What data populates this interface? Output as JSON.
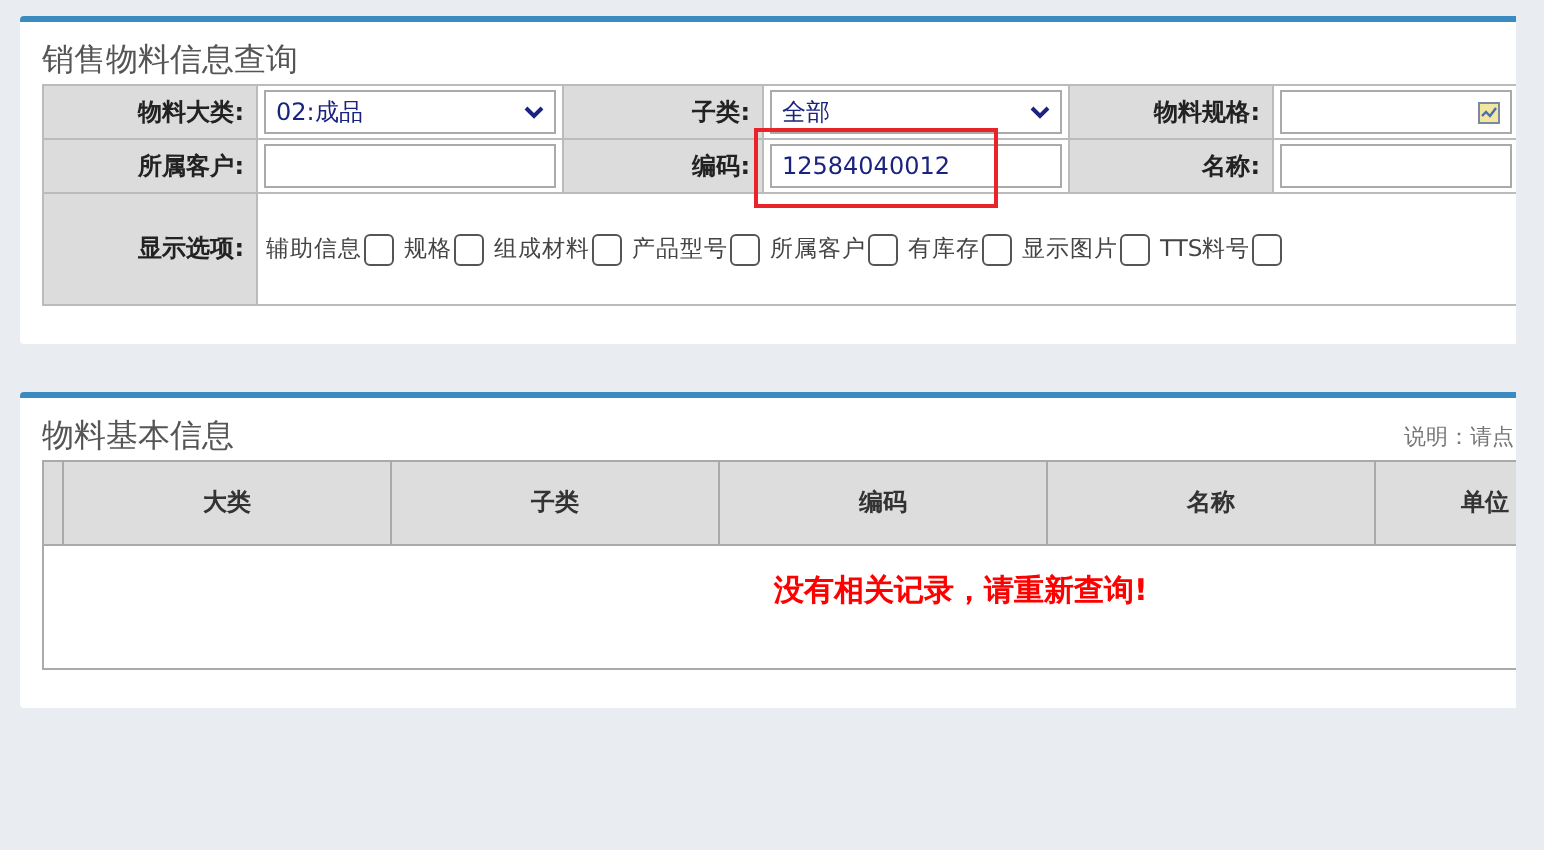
{
  "query_panel": {
    "title": "销售物料信息查询",
    "row_1": [
      {
        "label": "物料大类:",
        "kind": "select",
        "value": "02:成品"
      },
      {
        "label": "子类:",
        "kind": "select",
        "value": "全部"
      },
      {
        "label": "物料规格:",
        "kind": "picker"
      }
    ],
    "row_2": [
      {
        "label": "所属客户:",
        "kind": "text"
      },
      {
        "label": "编码:",
        "kind": "text",
        "value": "12584040012",
        "highlighted": true
      },
      {
        "label": "名称:",
        "kind": "text"
      }
    ],
    "options_label": "显示选项:",
    "options": [
      {
        "label": "辅助信息",
        "checked": false
      },
      {
        "label": "规格",
        "checked": false
      },
      {
        "label": "组成材料",
        "checked": false
      },
      {
        "label": "产品型号",
        "checked": false
      },
      {
        "label": "所属客户",
        "checked": false
      },
      {
        "label": "有库存",
        "checked": false
      },
      {
        "label": "显示图片",
        "checked": false
      },
      {
        "label": "TTS料号",
        "checked": false
      }
    ]
  },
  "result_panel": {
    "title": "物料基本信息",
    "note": "说明：请点",
    "columns": [
      "大类",
      "子类",
      "编码",
      "名称",
      "单位"
    ],
    "empty_message": "没有相关记录，请重新查询!"
  }
}
